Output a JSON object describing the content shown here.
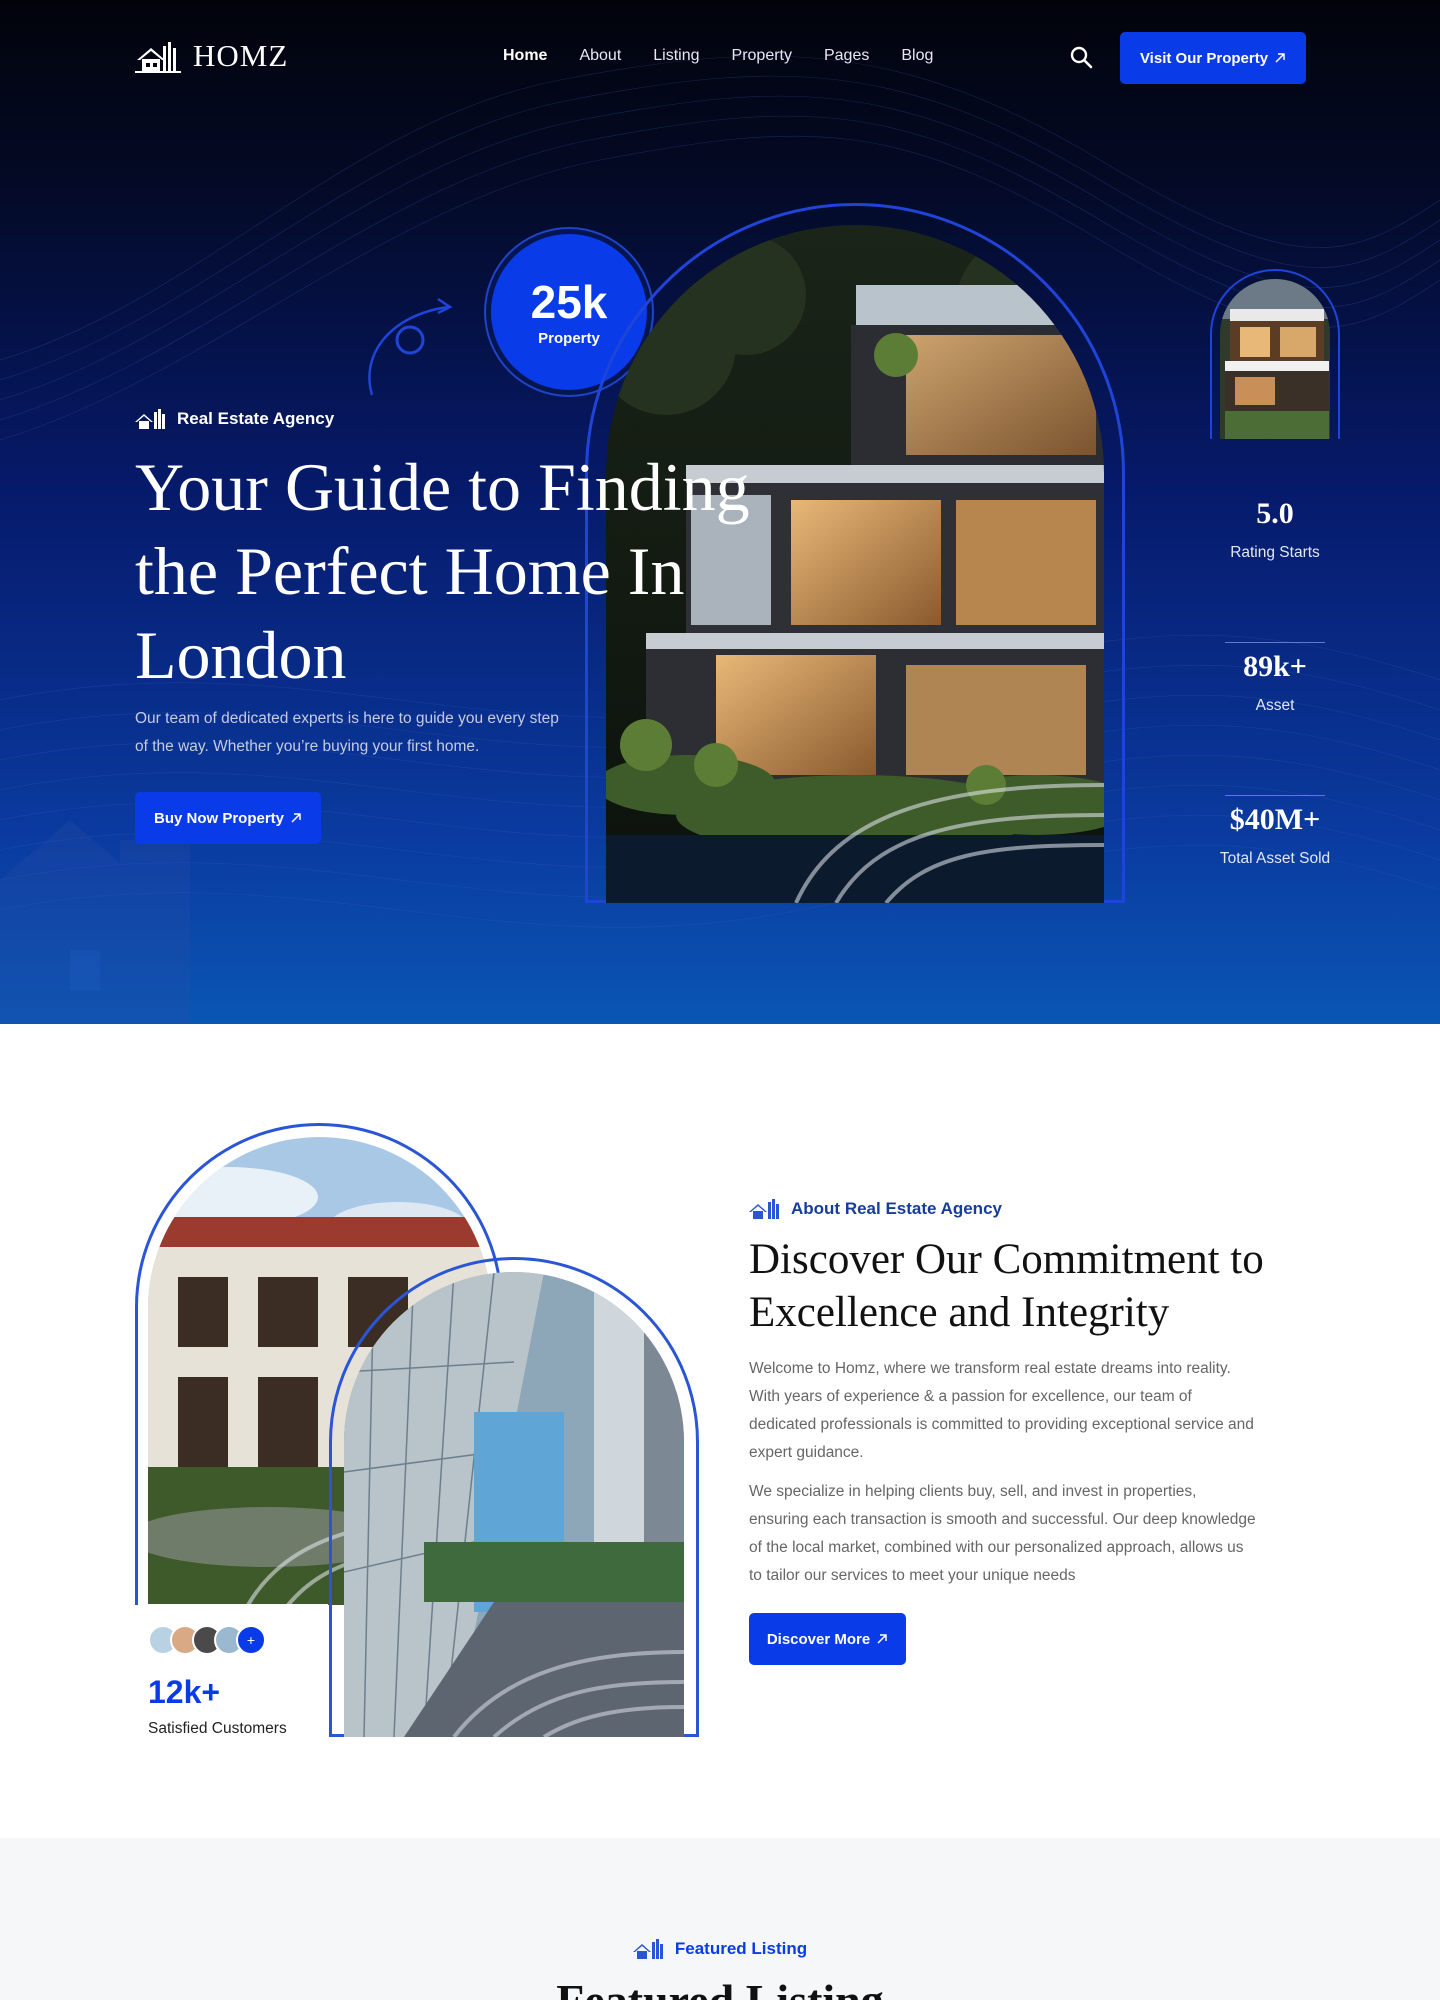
{
  "nav": {
    "logo_text": "HOMZ",
    "items": [
      {
        "label": "Home",
        "active": true
      },
      {
        "label": "About"
      },
      {
        "label": "Listing"
      },
      {
        "label": "Property"
      },
      {
        "label": "Pages"
      },
      {
        "label": "Blog"
      }
    ],
    "cta_label": "Visit Our Property"
  },
  "hero": {
    "badge": "Real Estate Agency",
    "title": "Your Guide to Finding the Perfect Home In London",
    "description": "Our team of dedicated experts is here to guide you every step of the way. Whether you’re buying your first home.",
    "button_label": "Buy Now Property",
    "circle_number": "25k",
    "circle_label": "Property",
    "stats": [
      {
        "value": "5.0",
        "label": "Rating Starts"
      },
      {
        "value": "89k+",
        "label": "Asset"
      },
      {
        "value": "$40M+",
        "label": "Total Asset Sold"
      }
    ]
  },
  "about": {
    "badge": "About Real Estate Agency",
    "title": "Discover Our Commitment to Excellence and Integrity",
    "paragraph1": "Welcome to Homz, where we transform real estate dreams into reality. With years of experience & a passion for excellence, our team of dedicated professionals is committed to providing exceptional service and expert guidance.",
    "paragraph2": "We specialize in helping clients buy, sell, and invest in properties, ensuring each transaction is smooth and successful. Our deep knowledge of the local market, combined with our personalized approach, allows us to tailor our services to meet your unique needs",
    "button_label": "Discover More",
    "customers_count": "12k+",
    "customers_label": "Satisfied Customers",
    "avatar_more": "+"
  },
  "featured": {
    "badge": "Featured Listing",
    "title": "Featured Listing"
  },
  "colors": {
    "accent": "#0a3be8",
    "hero_dark": "#02030a",
    "hero_blue": "#0a56b5",
    "outline": "#1f44d8"
  },
  "icons": {
    "logo": "house-logo-icon",
    "search": "search-icon",
    "arrow": "arrow-up-right-icon",
    "badge": "buildings-icon"
  }
}
